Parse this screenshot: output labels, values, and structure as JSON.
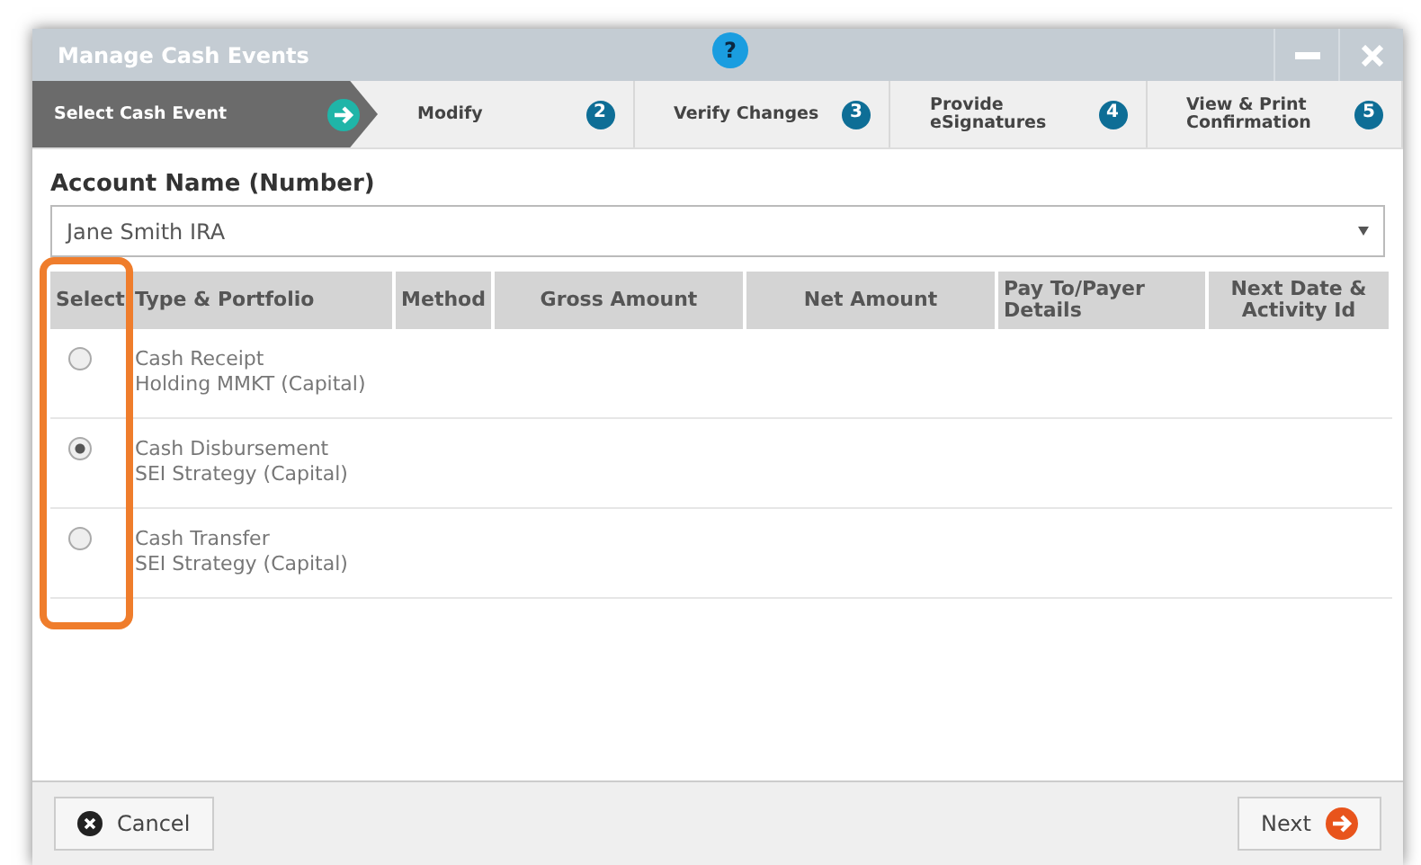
{
  "window": {
    "title": "Manage Cash Events",
    "help": "?"
  },
  "steps": [
    {
      "label": "Select Cash Event",
      "kind": "arrow",
      "selected": true
    },
    {
      "label": "Modify",
      "badge": "2",
      "kind": "number",
      "selected": false
    },
    {
      "label": "Verify Changes",
      "badge": "3",
      "kind": "number",
      "selected": false
    },
    {
      "label": "Provide eSignatures",
      "badge": "4",
      "kind": "number",
      "selected": false
    },
    {
      "label": "View & Print Confirmation",
      "badge": "5",
      "kind": "number",
      "selected": false
    }
  ],
  "account": {
    "label": "Account Name (Number)",
    "value": "Jane Smith IRA"
  },
  "table": {
    "columns": [
      "Select",
      "Type & Portfolio",
      "Method",
      "Gross Amount",
      "Net Amount",
      "Pay To/Payer Details",
      "Next Date & Activity Id"
    ],
    "rows": [
      {
        "type": "Cash Receipt",
        "portfolio": "Holding MMKT (Capital)",
        "selected": false
      },
      {
        "type": "Cash Disbursement",
        "portfolio": "SEI Strategy (Capital)",
        "selected": true
      },
      {
        "type": "Cash Transfer",
        "portfolio": "SEI Strategy (Capital)",
        "selected": false
      }
    ]
  },
  "highlight": {
    "on": true
  },
  "buttons": [
    {
      "label": "Cancel",
      "kind": "cancel"
    },
    {
      "label": "Next",
      "kind": "next"
    }
  ]
}
